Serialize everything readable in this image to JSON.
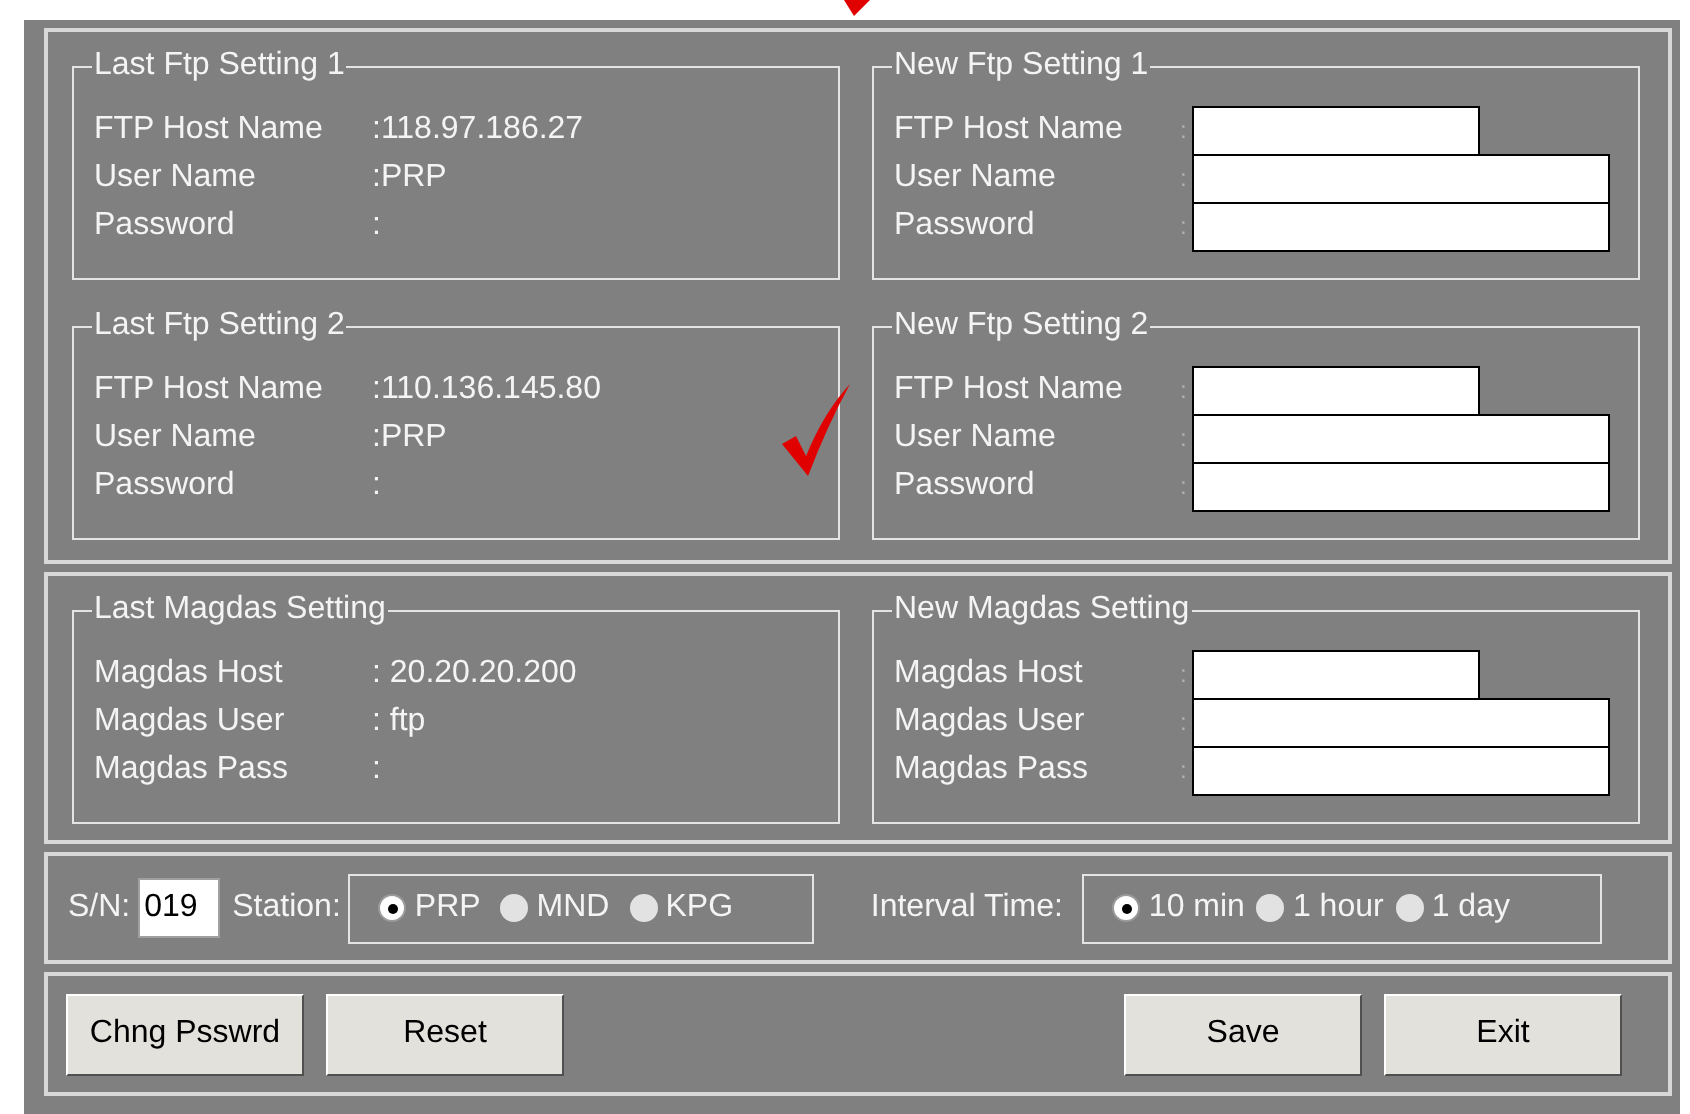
{
  "panels": [
    {
      "groups": [
        {
          "kind": "readout",
          "title": "Last Ftp Setting 1",
          "rows": [
            {
              "label": "FTP Host Name",
              "value": ":118.97.186.27"
            },
            {
              "label": "User Name",
              "value": ":PRP"
            },
            {
              "label": "Password",
              "value": ":"
            }
          ]
        },
        {
          "kind": "form",
          "title": "New Ftp Setting 1",
          "rows": [
            {
              "label": "FTP Host Name",
              "separator": ":",
              "kind": "short"
            },
            {
              "label": "User Name",
              "separator": ":",
              "kind": "long"
            },
            {
              "label": "Password",
              "separator": ":",
              "kind": "long"
            }
          ]
        },
        {
          "kind": "readout",
          "title": "Last Ftp Setting 2",
          "rows": [
            {
              "label": "FTP Host Name",
              "value": ":110.136.145.80"
            },
            {
              "label": "User Name",
              "value": ":PRP"
            },
            {
              "label": "Password",
              "value": ":"
            }
          ]
        },
        {
          "kind": "form",
          "title": "New Ftp Setting 2",
          "rows": [
            {
              "label": "FTP Host Name",
              "separator": ":",
              "kind": "short"
            },
            {
              "label": "User Name",
              "separator": ":",
              "kind": "long"
            },
            {
              "label": "Password",
              "separator": ":",
              "kind": "long"
            }
          ]
        }
      ]
    },
    {
      "groups": [
        {
          "kind": "readout",
          "title": "Last Magdas Setting",
          "rows": [
            {
              "label": "Magdas Host",
              "value": ": 20.20.20.200"
            },
            {
              "label": "Magdas User",
              "value": ": ftp"
            },
            {
              "label": "Magdas Pass",
              "value": ":"
            }
          ]
        },
        {
          "kind": "form",
          "title": "New Magdas Setting",
          "rows": [
            {
              "label": "Magdas Host",
              "separator": ":",
              "kind": "short"
            },
            {
              "label": "Magdas User",
              "separator": ":",
              "kind": "long"
            },
            {
              "label": "Magdas Pass",
              "separator": ":",
              "kind": "long"
            }
          ]
        }
      ]
    }
  ],
  "options": {
    "sn_label": "S/N:",
    "sn_value": "019",
    "station_label": "Station:",
    "stations": [
      {
        "label": "PRP",
        "selected": true
      },
      {
        "label": "MND",
        "selected": false
      },
      {
        "label": "KPG",
        "selected": false
      }
    ],
    "interval_label": "Interval Time:",
    "intervals": [
      {
        "label": "10 min",
        "selected": true
      },
      {
        "label": "1 hour",
        "selected": false
      },
      {
        "label": "1 day",
        "selected": false
      }
    ]
  },
  "buttons_left": [
    "Chng Psswrd",
    "Reset"
  ],
  "buttons_right": [
    "Save",
    "Exit"
  ]
}
